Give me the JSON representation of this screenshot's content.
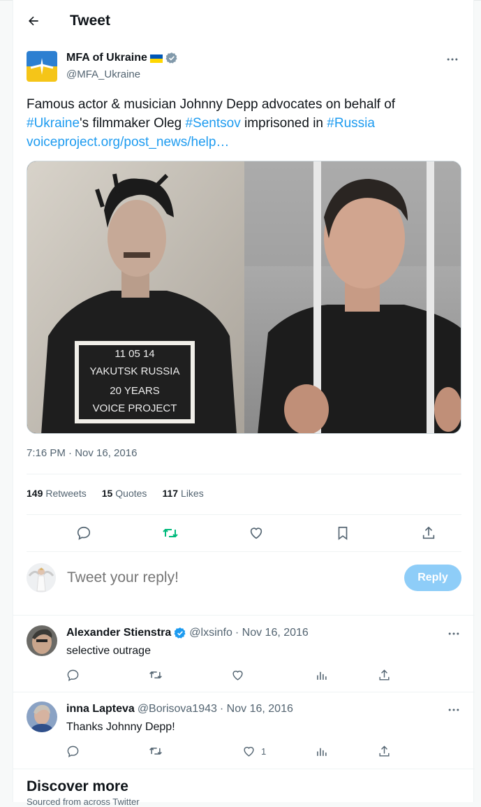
{
  "header": {
    "title": "Tweet"
  },
  "tweet": {
    "author_name": "MFA of Ukraine",
    "author_handle": "@MFA_Ukraine",
    "text_intro": "Famous actor & musician Johnny Depp advocates on behalf of",
    "hashtag_ukraine": "#Ukraine",
    "text_mid1": "'s filmmaker Oleg ",
    "hashtag_sentsov": "#Sentsov",
    "text_mid2": " imprisoned in ",
    "hashtag_russia": "#Russia",
    "link": "voiceproject.org/post_news/help…",
    "image": {
      "sign_line1": "11 05 14",
      "sign_line2": "YAKUTSK RUSSIA",
      "sign_line3": "20 YEARS",
      "sign_line4": "VOICE PROJECT"
    },
    "timestamp": "7:16 PM · Nov 16, 2016",
    "stats": {
      "retweets_count": "149",
      "retweets_label": "Retweets",
      "quotes_count": "15",
      "quotes_label": "Quotes",
      "likes_count": "117",
      "likes_label": "Likes"
    }
  },
  "compose": {
    "placeholder": "Tweet your reply!",
    "button_label": "Reply"
  },
  "replies": [
    {
      "name": "Alexander Stienstra",
      "handle": "@lxsinfo",
      "date": "· Nov 16, 2016",
      "text": "selective outrage",
      "likes": ""
    },
    {
      "name": "inna Lapteva",
      "handle": "@Borisova1943",
      "date": "· Nov 16, 2016",
      "text": "Thanks Johnny Depp!",
      "likes": "1"
    }
  ],
  "discover": {
    "title": "Discover more",
    "subtitle": "Sourced from across Twitter"
  },
  "colors": {
    "link": "#1d9bf0",
    "retweet_active": "#00ba7c",
    "reply_button": "#8ecdf8"
  }
}
